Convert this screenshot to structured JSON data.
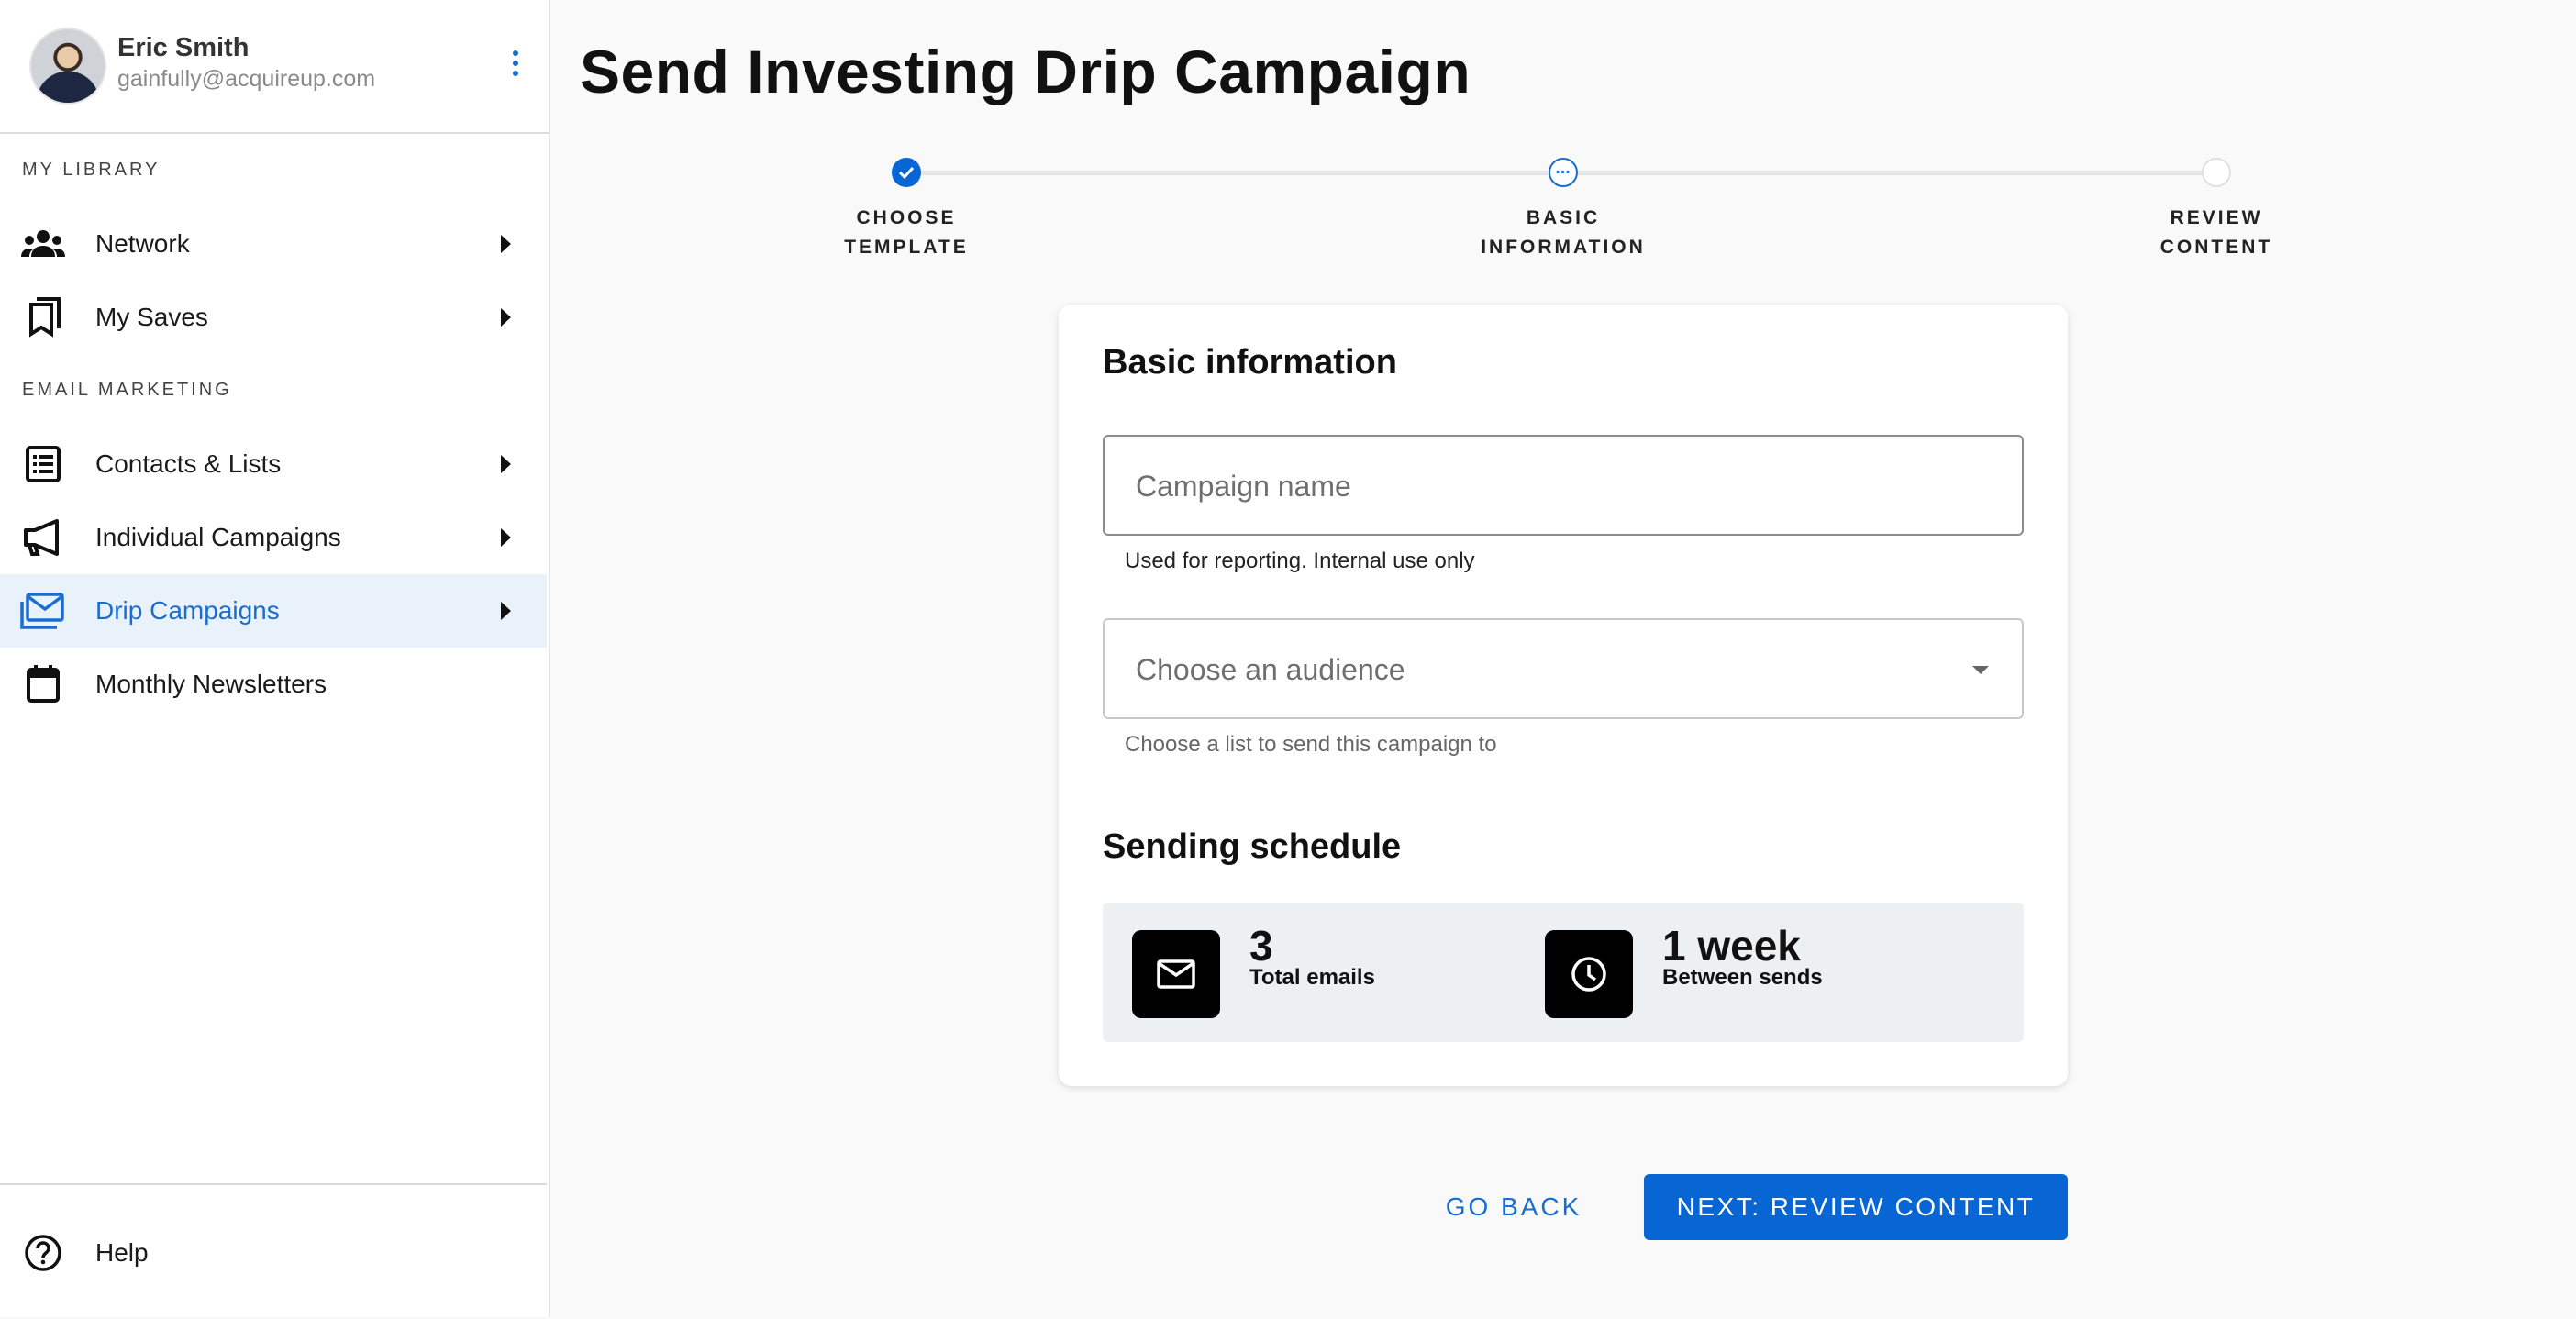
{
  "sidebar": {
    "profile": {
      "name": "Eric Smith",
      "email": "gainfully@acquireup.com"
    },
    "sections": {
      "library": "MY LIBRARY",
      "email_marketing": "EMAIL MARKETING"
    },
    "items": [
      {
        "label": "Network",
        "icon": "people-icon"
      },
      {
        "label": "My Saves",
        "icon": "bookmarks-icon"
      },
      {
        "label": "Contacts & Lists",
        "icon": "list-icon"
      },
      {
        "label": "Individual Campaigns",
        "icon": "megaphone-icon"
      },
      {
        "label": "Drip Campaigns",
        "icon": "email-drip-icon",
        "active": true
      },
      {
        "label": "Monthly Newsletters",
        "icon": "calendar-icon"
      }
    ],
    "help": {
      "label": "Help",
      "icon": "help-circle-icon"
    }
  },
  "main": {
    "title": "Send Investing Drip Campaign",
    "steps": [
      {
        "line1": "CHOOSE",
        "line2": "TEMPLATE",
        "state": "complete"
      },
      {
        "line1": "BASIC",
        "line2": "INFORMATION",
        "state": "current"
      },
      {
        "line1": "REVIEW",
        "line2": "CONTENT",
        "state": "upcoming"
      }
    ],
    "basic_info": {
      "heading": "Basic information",
      "campaign_name": {
        "value": "",
        "placeholder": "Campaign name",
        "helper": "Used for reporting. Internal use only"
      },
      "audience": {
        "placeholder": "Choose an audience",
        "helper": "Choose a list to send this campaign to"
      }
    },
    "schedule": {
      "heading": "Sending schedule",
      "total": {
        "value": "3",
        "caption": "Total emails"
      },
      "interval": {
        "value": "1 week",
        "caption": "Between sends"
      }
    },
    "actions": {
      "back": "GO BACK",
      "next": "NEXT: REVIEW CONTENT"
    }
  },
  "colors": {
    "accent": "#0865d4",
    "active_bg": "#e9f1fb",
    "schedule_bg": "#edf0f3"
  }
}
